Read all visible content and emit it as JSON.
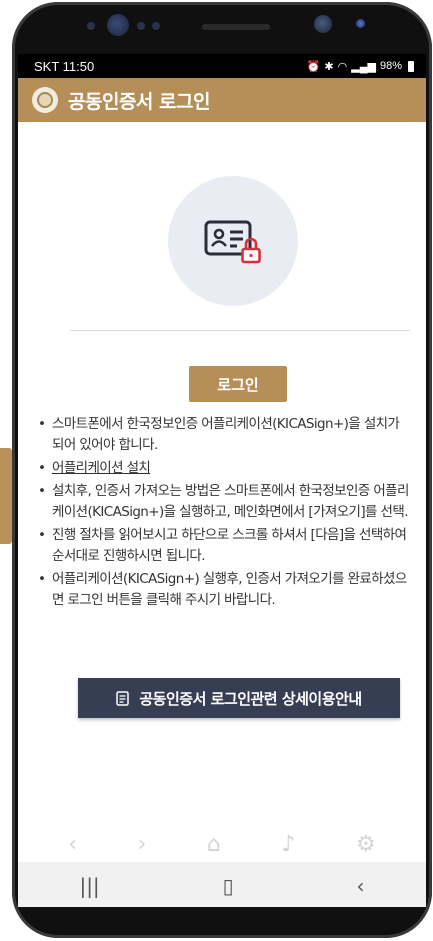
{
  "status_bar": {
    "carrier_time": "SKT 11:50",
    "battery": "98%"
  },
  "app_bar": {
    "title": "공동인증서 로그인"
  },
  "login_button": {
    "label": "로그인"
  },
  "instructions": {
    "item1": "스마트폰에서 한국정보인증 어플리케이션(KICASign+)을 설치가 되어 있어야 합니다.",
    "install_link": "어플리케이션 설치",
    "item3": "설치후, 인증서 가져오는 방법은 스마트폰에서 한국정보인증 어플리케이션(KICASign+)을 실행하고, 메인화면에서 [가져오기]를 선택.",
    "item4": "진행 절차를 읽어보시고 하단으로 스크롤 하셔서 [다음]을 선택하여 순서대로 진행하시면 됩니다.",
    "item5": "어플리케이션(KICASign+) 실행후, 인증서 가져오기를 완료하셨으면 로그인 버튼을 클릭해 주시기 바랍니다."
  },
  "guide_button": {
    "label": "공동인증서 로그인관련 상세이용안내"
  },
  "icons": {
    "hero": "id-card-lock-icon",
    "guide": "document-icon",
    "browser_toolbar": [
      "back-icon",
      "forward-icon",
      "home-icon",
      "bell-icon",
      "settings-icon"
    ],
    "system_nav": [
      "recent-apps-icon",
      "home-button-icon",
      "back-button-icon"
    ]
  },
  "colors": {
    "brand_gold": "#b68e57",
    "guide_button_bg": "#363e54",
    "hero_circle": "#e9ecf2",
    "lock_red": "#d7303a"
  }
}
